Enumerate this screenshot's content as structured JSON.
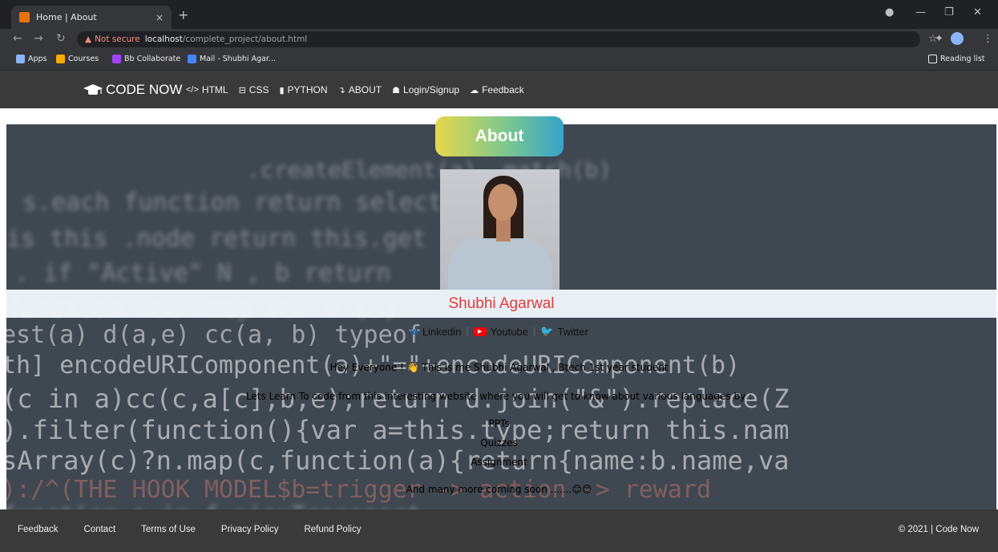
{
  "browser": {
    "tab_title": "Home | About",
    "tab_close": "×",
    "new_tab": "+",
    "warning_icon": "▲",
    "not_secure": "Not secure",
    "url_host": "localhost",
    "url_path": "/complete_project/about.html",
    "bookmarks": [
      {
        "label": "Apps",
        "color": "#8ab4f8"
      },
      {
        "label": "Courses",
        "color": "#f9ab00"
      },
      {
        "label": "Bb Collaborate",
        "color": "#a142f4"
      },
      {
        "label": "Mail - Shubhi Agar...",
        "color": "#4285f4"
      }
    ],
    "reading_list": "Reading list"
  },
  "nav": {
    "brand": "CODE NOW",
    "links": [
      {
        "icon": "</>",
        "label": "HTML"
      },
      {
        "icon": "⊟",
        "label": "CSS"
      },
      {
        "icon": "▮",
        "label": "PYTHON"
      },
      {
        "icon": "↴",
        "label": "ABOUT"
      },
      {
        "icon": "☗",
        "label": "Login/Signup"
      },
      {
        "icon": "☁",
        "label": "Feedback"
      }
    ]
  },
  "about": {
    "heading": "About",
    "name": "Shubhi Agarwal",
    "social": {
      "linkedin": "Linkedin",
      "youtube": "Youtube",
      "twitter": "Twitter",
      "separator": "|"
    },
    "intro": "Hey Everyone ! 👋 This is me Shubhi Agarwal , Btech 1st year student",
    "learn": "Lets Learn To code from this interesting website where you will get to know about various languages by :",
    "items": [
      "PPTs",
      "Quizzes",
      "Assignment"
    ],
    "more": "And many more coming soon .......😊😊"
  },
  "footer": {
    "links": [
      "Feedback",
      "Contact",
      "Terms of Use",
      "Privacy Policy",
      "Refund Policy"
    ],
    "copyright": "© 2021 | Code Now"
  },
  "colors": {
    "name": "#e23b3b",
    "navbar": "#3a3a3a",
    "pill_start": "#e7d84a",
    "pill_end": "#34a3c9"
  }
}
